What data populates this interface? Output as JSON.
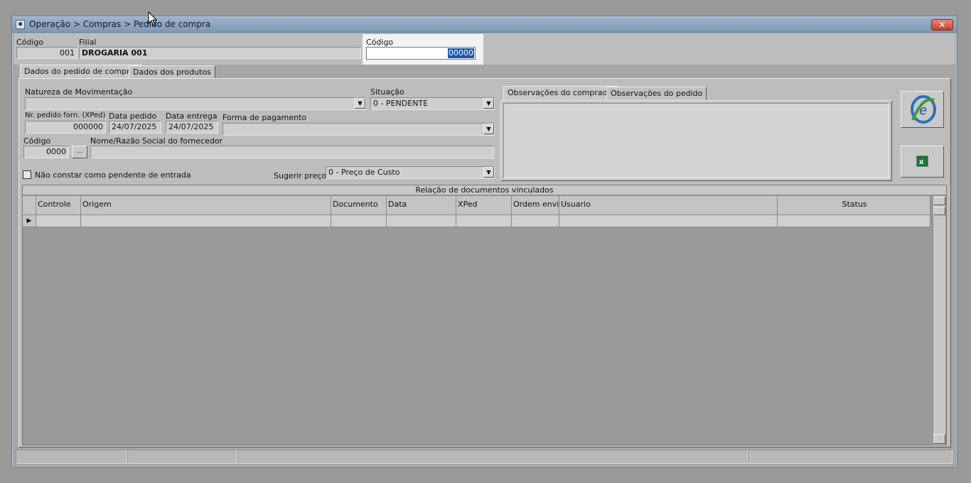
{
  "window": {
    "title": "Operação > Compras > Pedido de compra",
    "close_glyph": "✕"
  },
  "header": {
    "codigo_label": "Código",
    "codigo_value": "001",
    "filial_label": "Filial",
    "filial_value": "DROGARIA 001",
    "search_codigo_label": "Código",
    "search_codigo_value": "00000"
  },
  "tabs": [
    {
      "label": "Dados do pedido de compras",
      "active": true
    },
    {
      "label": "Dados dos produtos",
      "active": false
    }
  ],
  "form": {
    "natureza_label": "Natureza de Movimentação",
    "natureza_value": "",
    "situacao_label": "Situação",
    "situacao_value": "0 - PENDENTE",
    "nr_pedido_label": "Nr. pedido forn. (XPed)",
    "nr_pedido_value": "000000",
    "data_pedido_label": "Data pedido",
    "data_pedido_value": "24/07/2025",
    "data_entrega_label": "Data entrega",
    "data_entrega_value": "24/07/2025",
    "forma_pagamento_label": "Forma de pagamento",
    "forma_pagamento_value": "",
    "fornecedor_codigo_label": "Código",
    "fornecedor_codigo_value": "0000",
    "ellipsis_label": "...",
    "nome_fornecedor_label": "Nome/Razão Social do fornecedor",
    "nome_fornecedor_value": "",
    "nao_constar_label": "Não constar como pendente de entrada",
    "nao_constar_checked": false,
    "sugerir_preco_label": "Sugerir preço :",
    "sugerir_preco_value": "0 - Preço de Custo"
  },
  "obs_tabs": [
    {
      "label": "Observações do comprador",
      "active": true
    },
    {
      "label": "Observações do pedido",
      "active": false
    }
  ],
  "side_buttons": [
    {
      "icon": "nfe-icon"
    },
    {
      "icon": "excel-icon"
    }
  ],
  "grid": {
    "title": "Relação de documentos vinculados",
    "columns": [
      "Controle",
      "Origem",
      "Documento",
      "Data",
      "XPed",
      "Ordem envio",
      "Usuario",
      "Status"
    ],
    "row_indicator": "▶"
  },
  "colors": {
    "titlebar": "#8fa6be",
    "close": "#c9503c",
    "selection": "#1f57a8"
  }
}
